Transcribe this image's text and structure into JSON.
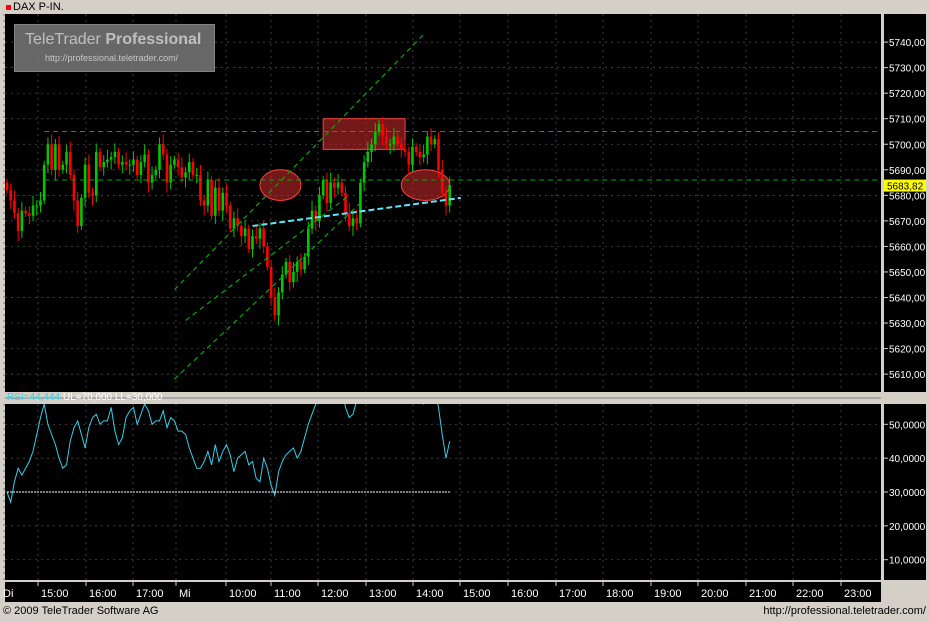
{
  "instrument": "DAX P-IN.",
  "logo": {
    "title_plain": "TeleTrader ",
    "title_bold": "Professional",
    "url": "http://professional.teletrader.com/"
  },
  "footer": {
    "copyright": "© 2009 TeleTrader Software AG",
    "url": "http://professional.teletrader.com/"
  },
  "rsi_label": {
    "value": "RSI=44,444",
    "params": " UL=70,000 LL=30,000"
  },
  "colors": {
    "background": "#000000",
    "up": "#00c800",
    "down": "#ff0000",
    "grid": "#555555",
    "trend": "#00aa00",
    "support": "#5ee6ff",
    "rsi": "#35d0e8",
    "highlight": "#c0282a"
  },
  "chart_data": [
    {
      "type": "candlestick",
      "title": "DAX P-IN.",
      "x_ticks": [
        "Di",
        "15:00",
        "16:00",
        "17:00",
        "Mi",
        "10:00",
        "11:00",
        "12:00",
        "13:00",
        "14:00",
        "15:00",
        "16:00",
        "17:00",
        "18:00",
        "19:00",
        "20:00",
        "21:00",
        "22:00",
        "23:00"
      ],
      "y_ticks": [
        "5610,00",
        "5620,00",
        "5630,00",
        "5640,00",
        "5650,00",
        "5660,00",
        "5670,00",
        "5680,00",
        "5690,00",
        "5700,00",
        "5710,00",
        "5720,00",
        "5730,00",
        "5740,00"
      ],
      "ylim": [
        5603,
        5751
      ],
      "last_price": "5683,82",
      "closes": [
        5682,
        5678,
        5673,
        5666,
        5674,
        5673,
        5672,
        5676,
        5676,
        5678,
        5692,
        5700,
        5690,
        5700,
        5690,
        5692,
        5697,
        5688,
        5678,
        5668,
        5679,
        5692,
        5681,
        5680,
        5697,
        5691,
        5693,
        5694,
        5695,
        5697,
        5692,
        5693,
        5692,
        5692,
        5694,
        5688,
        5693,
        5696,
        5685,
        5688,
        5690,
        5700,
        5696,
        5685,
        5692,
        5694,
        5691,
        5687,
        5689,
        5693,
        5688,
        5688,
        5678,
        5676,
        5686,
        5672,
        5683,
        5674,
        5681,
        5676,
        5667,
        5671,
        5668,
        5664,
        5667,
        5659,
        5664,
        5663,
        5667,
        5660,
        5652,
        5640,
        5633,
        5642,
        5649,
        5654,
        5646,
        5650,
        5654,
        5651,
        5656,
        5667,
        5674,
        5670,
        5680,
        5686,
        5677,
        5685,
        5683,
        5685,
        5681,
        5673,
        5668,
        5671,
        5669,
        5685,
        5693,
        5697,
        5700,
        5705,
        5708,
        5703,
        5700,
        5700,
        5703,
        5700,
        5698,
        5697,
        5692,
        5699,
        5697,
        5695,
        5696,
        5703,
        5700,
        5702,
        5690,
        5681,
        5676,
        5684
      ],
      "range_sample": {
        "low": 5632,
        "high": 5710
      },
      "overlays": {
        "horizontal_levels": [
          5705,
          5686
        ],
        "support_line": {
          "from": [
            66,
            5668
          ],
          "to": [
            122,
            5679
          ]
        },
        "channel_upper": {
          "from": [
            45,
            5643
          ],
          "to": [
            112,
            5743
          ]
        },
        "channel_lower": {
          "from": [
            45,
            5608
          ],
          "to": [
            95,
            5677
          ]
        },
        "channel_mid": {
          "from": [
            48,
            5631
          ],
          "to": [
            92,
            5680
          ]
        },
        "highlight_boxes": [
          {
            "shape": "ellipse",
            "x": [
              68,
              79
            ],
            "y": [
              5678,
              5690
            ]
          },
          {
            "shape": "rect",
            "x": [
              85,
              107
            ],
            "y": [
              5698,
              5710
            ]
          },
          {
            "shape": "ellipse",
            "x": [
              106,
              119
            ],
            "y": [
              5678,
              5690
            ]
          }
        ]
      }
    },
    {
      "type": "line",
      "title": "RSI",
      "ylim": [
        4,
        56
      ],
      "y_ticks": [
        "10,0000",
        "20,0000",
        "30,0000",
        "40,0000",
        "50,0000"
      ],
      "lower_limit": 30,
      "upper_limit": 70,
      "values": [
        30,
        27,
        33,
        37,
        35,
        37,
        39,
        42,
        47,
        52,
        56,
        50,
        47,
        44,
        40,
        37,
        38,
        45,
        49,
        51,
        47,
        43,
        49,
        52,
        53,
        50,
        51,
        51,
        55,
        48,
        44,
        46,
        52,
        54,
        55,
        50,
        53,
        56,
        54,
        50,
        51,
        51,
        54,
        49,
        52,
        51,
        48,
        48,
        47,
        43,
        40,
        37,
        37,
        39,
        42,
        38,
        44,
        39,
        42,
        44,
        41,
        36,
        40,
        41,
        42,
        38,
        39,
        34,
        33,
        40,
        37,
        32,
        29,
        36,
        39,
        41,
        42,
        43,
        40,
        42,
        46,
        50,
        53,
        56,
        57,
        60,
        62,
        61,
        62,
        63,
        61,
        55,
        52,
        53,
        57,
        59,
        62,
        65,
        68,
        72,
        75,
        71,
        70,
        68,
        66,
        64,
        62,
        60,
        58,
        60,
        59,
        57,
        56,
        58,
        62,
        60,
        55,
        47,
        40,
        45
      ]
    }
  ]
}
